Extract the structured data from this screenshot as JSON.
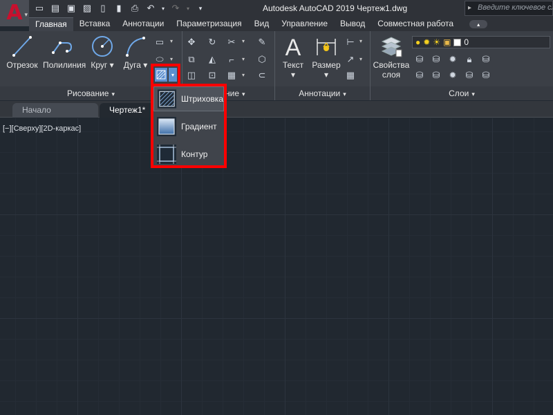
{
  "app": {
    "logo_letter": "A",
    "title": "Autodesk AutoCAD 2019    Чертеж1.dwg"
  },
  "search": {
    "placeholder": "Введите ключевое слово"
  },
  "tabs": [
    {
      "label": "Главная"
    },
    {
      "label": "Вставка"
    },
    {
      "label": "Аннотации"
    },
    {
      "label": "Параметризация"
    },
    {
      "label": "Вид"
    },
    {
      "label": "Управление"
    },
    {
      "label": "Вывод"
    },
    {
      "label": "Совместная работа"
    }
  ],
  "ribbon": {
    "draw": {
      "title": "Рисование",
      "line": "Отрезок",
      "polyline": "Полилиния",
      "circle": "Круг",
      "arc": "Дуга"
    },
    "modify": {
      "title": "ование"
    },
    "annotation": {
      "title": "Аннотации",
      "text": "Текст",
      "dimension": "Размер"
    },
    "layers": {
      "title": "Слои",
      "properties": "Свойства слоя",
      "current_layer": "0"
    }
  },
  "doc_tabs": [
    {
      "label": "Начало"
    },
    {
      "label": "Чертеж1*"
    }
  ],
  "viewport": {
    "label": "[−][Сверху][2D-каркас]"
  },
  "hatch_menu": {
    "items": [
      {
        "label": "Штриховка"
      },
      {
        "label": "Градиент"
      },
      {
        "label": "Контур"
      }
    ]
  },
  "colors": {
    "highlight": "#ff0000",
    "logo": "#c8102e",
    "canvas": "#212830"
  }
}
